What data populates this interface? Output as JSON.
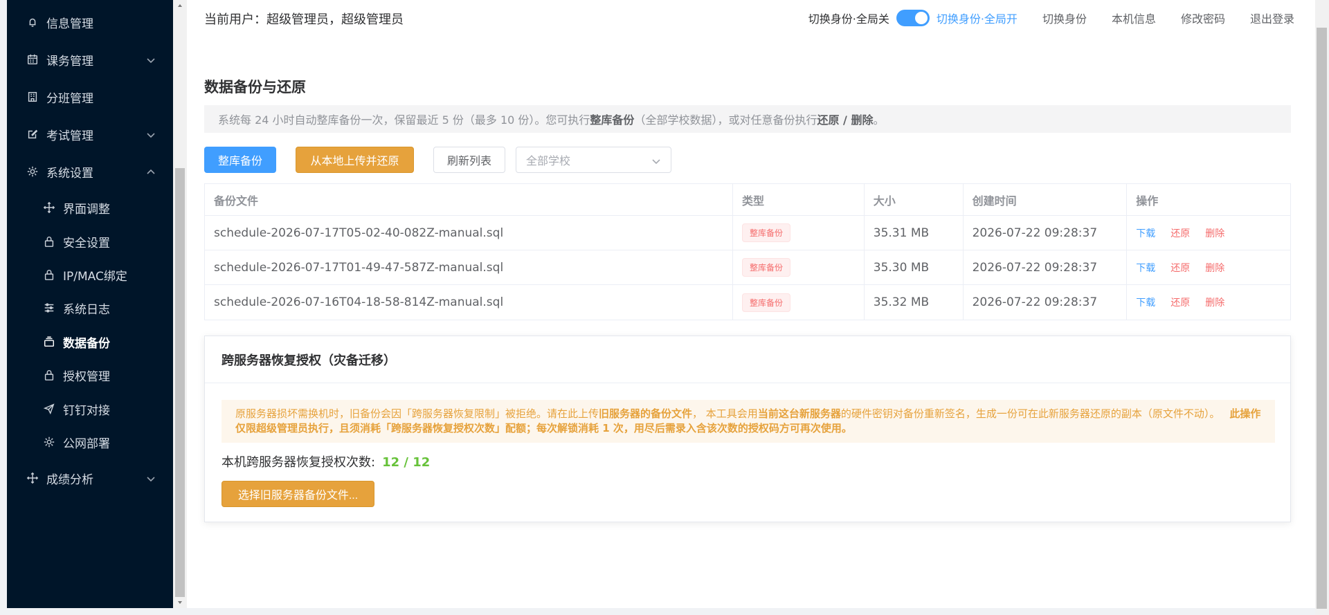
{
  "sidebar": {
    "items": [
      {
        "label": "信息管理",
        "icon": "bell-icon",
        "type": "top",
        "chevron": ""
      },
      {
        "label": "课务管理",
        "icon": "calendar-icon",
        "type": "top",
        "chevron": "down"
      },
      {
        "label": "分班管理",
        "icon": "building-icon",
        "type": "top",
        "chevron": ""
      },
      {
        "label": "考试管理",
        "icon": "edit-icon",
        "type": "top",
        "chevron": "down"
      },
      {
        "label": "系统设置",
        "icon": "gear-icon",
        "type": "top",
        "chevron": "up"
      },
      {
        "label": "界面调整",
        "icon": "move-icon",
        "type": "sub"
      },
      {
        "label": "安全设置",
        "icon": "lock-icon",
        "type": "sub"
      },
      {
        "label": "IP/MAC绑定",
        "icon": "lock-icon",
        "type": "sub"
      },
      {
        "label": "系统日志",
        "icon": "sliders-icon",
        "type": "sub"
      },
      {
        "label": "数据备份",
        "icon": "stack-icon",
        "type": "sub",
        "active": true
      },
      {
        "label": "授权管理",
        "icon": "lock-icon",
        "type": "sub"
      },
      {
        "label": "钉钉对接",
        "icon": "send-icon",
        "type": "sub"
      },
      {
        "label": "公网部署",
        "icon": "gear-icon",
        "type": "sub"
      },
      {
        "label": "成绩分析",
        "icon": "move-icon",
        "type": "top",
        "chevron": "down"
      }
    ]
  },
  "header": {
    "current_user": "当前用户：超级管理员，超级管理员",
    "switch_off_label": "切换身份·全局关",
    "switch_on_label": "切换身份·全局开",
    "links": [
      "切换身份",
      "本机信息",
      "修改密码",
      "退出登录"
    ]
  },
  "page": {
    "title": "数据备份与还原",
    "notice_pre": "系统每 24 小时自动整库备份一次，保留最近 5 份（最多 10 份）。您可执行",
    "notice_b1": "整库备份",
    "notice_mid": "（全部学校数据），或对任意备份执行",
    "notice_b2": "还原 / 删除",
    "notice_end": "。"
  },
  "toolbar": {
    "backup_label": "整库备份",
    "upload_label": "从本地上传并还原",
    "refresh_label": "刷新列表",
    "school_placeholder": "全部学校"
  },
  "table": {
    "headers": [
      "备份文件",
      "类型",
      "大小",
      "创建时间",
      "操作"
    ],
    "rows": [
      {
        "file": "schedule-2026-07-17T05-02-40-082Z-manual.sql",
        "type": "整库备份",
        "size": "35.31 MB",
        "time": "2026-07-22 09:28:37"
      },
      {
        "file": "schedule-2026-07-17T01-49-47-587Z-manual.sql",
        "type": "整库备份",
        "size": "35.30 MB",
        "time": "2026-07-22 09:28:37"
      },
      {
        "file": "schedule-2026-07-16T04-18-58-814Z-manual.sql",
        "type": "整库备份",
        "size": "35.32 MB",
        "time": "2026-07-22 09:28:37"
      }
    ],
    "actions": {
      "download": "下载",
      "restore": "还原",
      "delete": "删除"
    }
  },
  "card": {
    "title": "跨服务器恢复授权（灾备迁移）",
    "warn_1": "原服务器损坏需换机时，旧备份会因「跨服务器恢复限制」被拒绝。请在此上传",
    "warn_b1": "旧服务器的备份文件",
    "warn_2": "， 本工具会用",
    "warn_b2": "当前这台新服务器",
    "warn_3": "的硬件密钥对备份重新签名，生成一份可在此新服务器还原的副本（原文件不动）。",
    "warn_b3": "此操作仅限超级管理员执行，且须消耗「跨服务器恢复授权次数」配额；每次解锁消耗 1 次，用尽后需录入含该次数的授权码方可再次使用。",
    "quota_label": "本机跨服务器恢复授权次数:",
    "quota_value": "12 / 12",
    "select_file_label": "选择旧服务器备份文件..."
  },
  "colors": {
    "sidebar_bg": "#001529",
    "primary": "#409eff",
    "warning": "#e6a23c",
    "danger": "#f56c6c",
    "success": "#67c23a"
  }
}
